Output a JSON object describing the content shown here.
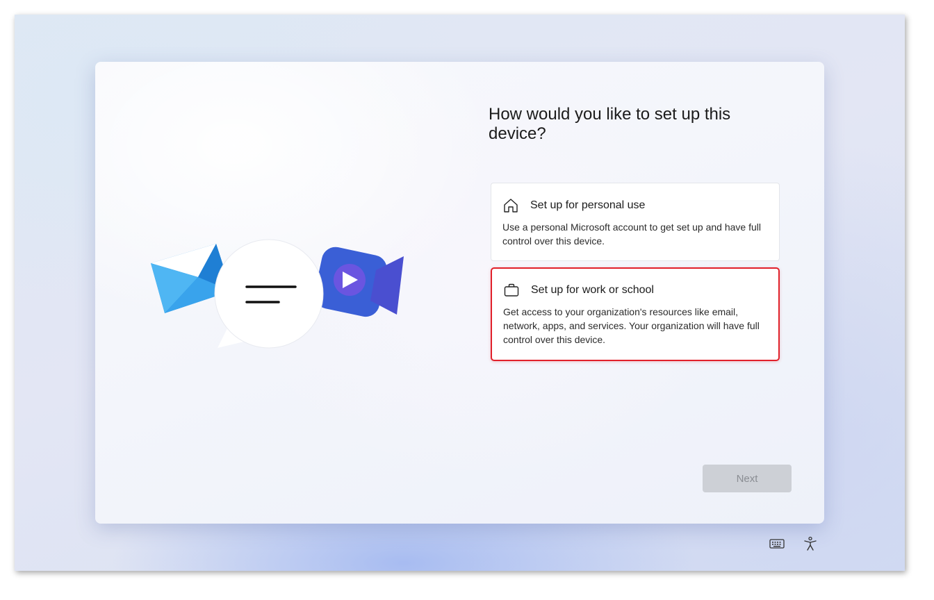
{
  "dialog": {
    "title": "How would you like to set up this device?",
    "options": [
      {
        "icon": "home-icon",
        "title": "Set up for personal use",
        "description": "Use a personal Microsoft account to get set up and have full control over this device."
      },
      {
        "icon": "briefcase-icon",
        "title": "Set up for work or school",
        "description": "Get access to your organization's resources like email, network, apps, and services. Your organization will have full control over this device.",
        "highlighted": true
      }
    ],
    "next_label": "Next"
  },
  "illustration": {
    "icons": [
      "mail-envelope-icon",
      "chat-bubble-icon",
      "video-camera-icon"
    ]
  },
  "taskbar": {
    "icons": [
      "keyboard-icon",
      "accessibility-icon"
    ]
  },
  "colors": {
    "highlight": "#e1202a",
    "button_disabled": "#cdd0d6"
  }
}
